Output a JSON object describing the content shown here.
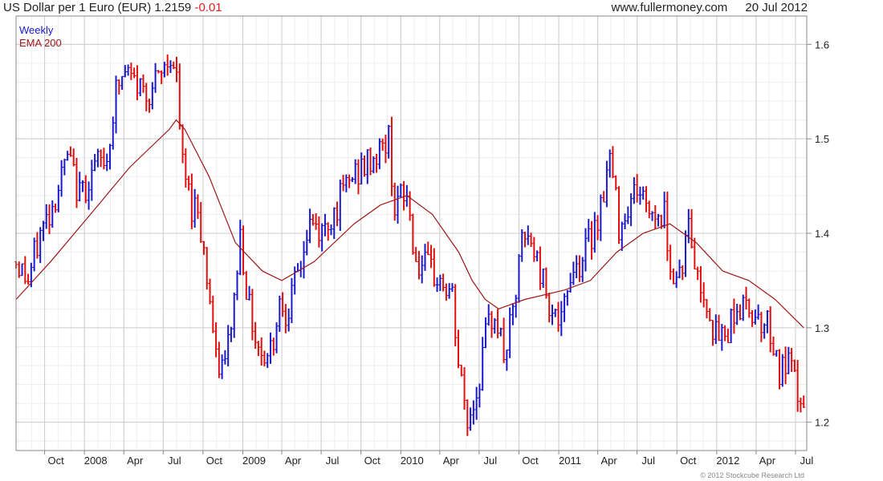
{
  "header": {
    "title": "US Dollar per 1 Euro (EUR)",
    "price": "1.2159",
    "change": "-0.01",
    "site": "www.fullermoney.com",
    "date": "20 Jul 2012"
  },
  "copyright": "© 2012 Stockcube Research Ltd",
  "colors": {
    "up": "#1a1acc",
    "down": "#e01010",
    "ema": "#a01818",
    "grid": "#dddddd",
    "axis": "#888888"
  },
  "chart_data": {
    "type": "line",
    "ylim": [
      1.17,
      1.63
    ],
    "yticks": [
      1.2,
      1.3,
      1.4,
      1.5,
      1.6
    ],
    "xlim": [
      "2007-07-27",
      "2012-07-27"
    ],
    "xticks": [
      {
        "date": "2007-10-01",
        "label": "Oct"
      },
      {
        "date": "2008-01-01",
        "label": "2008"
      },
      {
        "date": "2008-04-01",
        "label": "Apr"
      },
      {
        "date": "2008-07-01",
        "label": "Jul"
      },
      {
        "date": "2008-10-01",
        "label": "Oct"
      },
      {
        "date": "2009-01-01",
        "label": "2009"
      },
      {
        "date": "2009-04-01",
        "label": "Apr"
      },
      {
        "date": "2009-07-01",
        "label": "Jul"
      },
      {
        "date": "2009-10-01",
        "label": "Oct"
      },
      {
        "date": "2010-01-01",
        "label": "2010"
      },
      {
        "date": "2010-04-01",
        "label": "Apr"
      },
      {
        "date": "2010-07-01",
        "label": "Jul"
      },
      {
        "date": "2010-10-01",
        "label": "Oct"
      },
      {
        "date": "2011-01-01",
        "label": "2011"
      },
      {
        "date": "2011-04-01",
        "label": "Apr"
      },
      {
        "date": "2011-07-01",
        "label": "Jul"
      },
      {
        "date": "2011-10-01",
        "label": "Oct"
      },
      {
        "date": "2012-01-01",
        "label": "2012"
      },
      {
        "date": "2012-04-01",
        "label": "Apr"
      },
      {
        "date": "2012-07-01",
        "label": "Jul"
      }
    ],
    "legend": [
      "Weekly",
      "EMA 200"
    ],
    "series": [
      {
        "name": "Weekly",
        "style": "ohlc-bars",
        "points": [
          [
            "2007-07-27",
            1.37
          ],
          [
            "2007-08-24",
            1.35
          ],
          [
            "2007-09-21",
            1.4
          ],
          [
            "2007-10-19",
            1.43
          ],
          [
            "2007-11-23",
            1.48
          ],
          [
            "2007-12-21",
            1.44
          ],
          [
            "2008-01-25",
            1.47
          ],
          [
            "2008-02-22",
            1.48
          ],
          [
            "2008-03-14",
            1.55
          ],
          [
            "2008-04-04",
            1.57
          ],
          [
            "2008-04-25",
            1.56
          ],
          [
            "2008-05-23",
            1.55
          ],
          [
            "2008-06-20",
            1.56
          ],
          [
            "2008-07-18",
            1.59
          ],
          [
            "2008-08-01",
            1.56
          ],
          [
            "2008-08-15",
            1.47
          ],
          [
            "2008-09-05",
            1.43
          ],
          [
            "2008-09-19",
            1.43
          ],
          [
            "2008-10-03",
            1.38
          ],
          [
            "2008-10-17",
            1.33
          ],
          [
            "2008-10-31",
            1.26
          ],
          [
            "2008-11-21",
            1.26
          ],
          [
            "2008-12-12",
            1.33
          ],
          [
            "2008-12-26",
            1.4
          ],
          [
            "2009-01-16",
            1.32
          ],
          [
            "2009-02-06",
            1.28
          ],
          [
            "2009-02-27",
            1.27
          ],
          [
            "2009-03-13",
            1.29
          ],
          [
            "2009-03-27",
            1.33
          ],
          [
            "2009-04-10",
            1.32
          ],
          [
            "2009-04-24",
            1.33
          ],
          [
            "2009-05-15",
            1.37
          ],
          [
            "2009-06-05",
            1.41
          ],
          [
            "2009-07-03",
            1.4
          ],
          [
            "2009-08-07",
            1.43
          ],
          [
            "2009-09-11",
            1.46
          ],
          [
            "2009-10-09",
            1.47
          ],
          [
            "2009-10-30",
            1.48
          ],
          [
            "2009-11-20",
            1.49
          ],
          [
            "2009-12-04",
            1.5
          ],
          [
            "2009-12-18",
            1.43
          ],
          [
            "2010-01-15",
            1.44
          ],
          [
            "2010-02-05",
            1.37
          ],
          [
            "2010-03-05",
            1.36
          ],
          [
            "2010-04-02",
            1.35
          ],
          [
            "2010-04-30",
            1.33
          ],
          [
            "2010-05-14",
            1.26
          ],
          [
            "2010-06-04",
            1.2
          ],
          [
            "2010-06-25",
            1.23
          ],
          [
            "2010-07-16",
            1.29
          ],
          [
            "2010-08-06",
            1.32
          ],
          [
            "2010-08-27",
            1.27
          ],
          [
            "2010-09-17",
            1.31
          ],
          [
            "2010-10-08",
            1.39
          ],
          [
            "2010-10-29",
            1.39
          ],
          [
            "2010-11-19",
            1.36
          ],
          [
            "2010-12-10",
            1.33
          ],
          [
            "2011-01-07",
            1.3
          ],
          [
            "2011-01-28",
            1.36
          ],
          [
            "2011-02-18",
            1.37
          ],
          [
            "2011-03-11",
            1.39
          ],
          [
            "2011-04-08",
            1.43
          ],
          [
            "2011-04-29",
            1.48
          ],
          [
            "2011-05-20",
            1.41
          ],
          [
            "2011-06-10",
            1.43
          ],
          [
            "2011-07-01",
            1.45
          ],
          [
            "2011-07-22",
            1.43
          ],
          [
            "2011-08-12",
            1.42
          ],
          [
            "2011-09-02",
            1.42
          ],
          [
            "2011-09-23",
            1.35
          ],
          [
            "2011-10-14",
            1.37
          ],
          [
            "2011-10-28",
            1.41
          ],
          [
            "2011-11-18",
            1.35
          ],
          [
            "2011-12-09",
            1.33
          ],
          [
            "2011-12-30",
            1.29
          ],
          [
            "2012-01-20",
            1.29
          ],
          [
            "2012-02-10",
            1.32
          ],
          [
            "2012-03-02",
            1.32
          ],
          [
            "2012-03-23",
            1.32
          ],
          [
            "2012-04-13",
            1.31
          ],
          [
            "2012-05-04",
            1.3
          ],
          [
            "2012-05-25",
            1.25
          ],
          [
            "2012-06-15",
            1.26
          ],
          [
            "2012-07-06",
            1.23
          ],
          [
            "2012-07-20",
            1.2159
          ]
        ]
      },
      {
        "name": "EMA 200",
        "style": "line",
        "points": [
          [
            "2007-07-27",
            1.33
          ],
          [
            "2007-10-15",
            1.37
          ],
          [
            "2008-01-15",
            1.42
          ],
          [
            "2008-04-15",
            1.47
          ],
          [
            "2008-07-15",
            1.51
          ],
          [
            "2008-07-31",
            1.52
          ],
          [
            "2008-08-20",
            1.51
          ],
          [
            "2008-10-15",
            1.46
          ],
          [
            "2008-12-15",
            1.39
          ],
          [
            "2009-02-15",
            1.36
          ],
          [
            "2009-04-01",
            1.35
          ],
          [
            "2009-06-15",
            1.37
          ],
          [
            "2009-09-15",
            1.41
          ],
          [
            "2009-11-15",
            1.43
          ],
          [
            "2010-01-15",
            1.44
          ],
          [
            "2010-03-15",
            1.42
          ],
          [
            "2010-05-15",
            1.38
          ],
          [
            "2010-06-15",
            1.35
          ],
          [
            "2010-07-15",
            1.33
          ],
          [
            "2010-08-15",
            1.32
          ],
          [
            "2010-10-15",
            1.33
          ],
          [
            "2011-01-15",
            1.34
          ],
          [
            "2011-03-15",
            1.35
          ],
          [
            "2011-05-15",
            1.38
          ],
          [
            "2011-07-15",
            1.4
          ],
          [
            "2011-09-15",
            1.41
          ],
          [
            "2011-11-15",
            1.39
          ],
          [
            "2012-01-15",
            1.36
          ],
          [
            "2012-03-15",
            1.35
          ],
          [
            "2012-05-15",
            1.33
          ],
          [
            "2012-07-20",
            1.3
          ]
        ]
      }
    ]
  }
}
